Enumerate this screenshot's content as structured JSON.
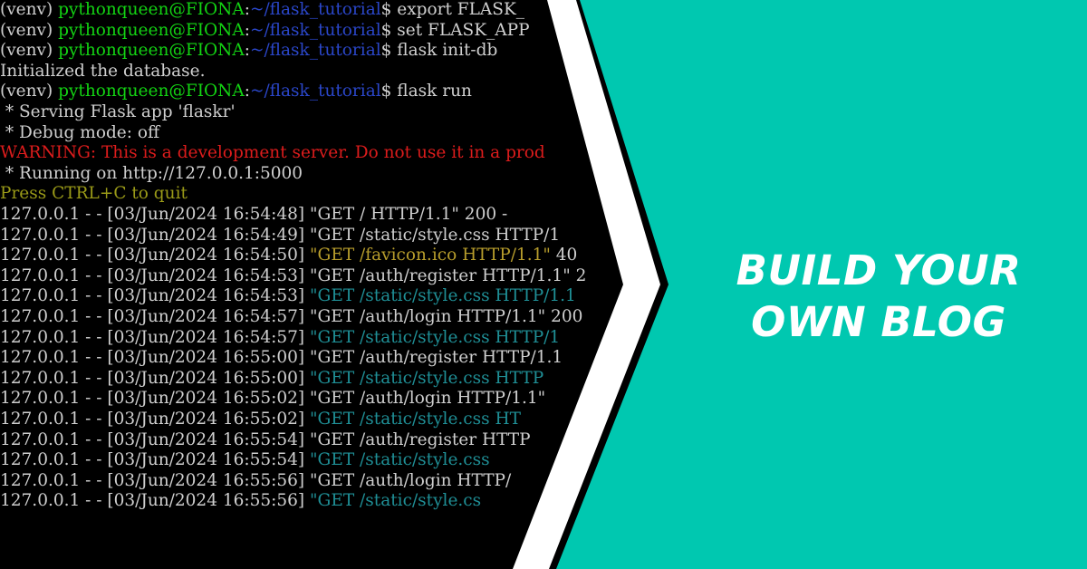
{
  "terminal": {
    "lines": [
      [
        {
          "t": "(venv) ",
          "c": "white"
        },
        {
          "t": "pythonqueen@FIONA",
          "c": "green"
        },
        {
          "t": ":",
          "c": "white"
        },
        {
          "t": "~/flask_tutorial",
          "c": "blue"
        },
        {
          "t": "$ export FLASK_",
          "c": "white"
        }
      ],
      [
        {
          "t": "(venv) ",
          "c": "white"
        },
        {
          "t": "pythonqueen@FIONA",
          "c": "green"
        },
        {
          "t": ":",
          "c": "white"
        },
        {
          "t": "~/flask_tutorial",
          "c": "blue"
        },
        {
          "t": "$ set FLASK_APP",
          "c": "white"
        }
      ],
      [
        {
          "t": "(venv) ",
          "c": "white"
        },
        {
          "t": "pythonqueen@FIONA",
          "c": "green"
        },
        {
          "t": ":",
          "c": "white"
        },
        {
          "t": "~/flask_tutorial",
          "c": "blue"
        },
        {
          "t": "$ flask init-db",
          "c": "white"
        }
      ],
      [
        {
          "t": "Initialized the database.",
          "c": "white"
        }
      ],
      [
        {
          "t": "(venv) ",
          "c": "white"
        },
        {
          "t": "pythonqueen@FIONA",
          "c": "green"
        },
        {
          "t": ":",
          "c": "white"
        },
        {
          "t": "~/flask_tutorial",
          "c": "blue"
        },
        {
          "t": "$ flask run",
          "c": "white"
        }
      ],
      [
        {
          "t": " * Serving Flask app 'flaskr'",
          "c": "white"
        }
      ],
      [
        {
          "t": " * Debug mode: off",
          "c": "white"
        }
      ],
      [
        {
          "t": "WARNING: This is a development server. Do not use it in a prod",
          "c": "red"
        }
      ],
      [
        {
          "t": " * Running on http://127.0.0.1:5000",
          "c": "white"
        }
      ],
      [
        {
          "t": "Press CTRL+C to quit",
          "c": "olive"
        }
      ],
      [
        {
          "t": "127.0.0.1 - - [03/Jun/2024 16:54:48] \"GET / HTTP/1.1\" 200 -",
          "c": "white"
        }
      ],
      [
        {
          "t": "127.0.0.1 - - [03/Jun/2024 16:54:49] \"GET /static/style.css HTTP/1",
          "c": "white"
        }
      ],
      [
        {
          "t": "127.0.0.1 - - [03/Jun/2024 16:54:50] ",
          "c": "white"
        },
        {
          "t": "\"GET /favicon.ico HTTP/1.1\"",
          "c": "amber"
        },
        {
          "t": " 40",
          "c": "white"
        }
      ],
      [
        {
          "t": "127.0.0.1 - - [03/Jun/2024 16:54:53] \"GET /auth/register HTTP/1.1\" 2",
          "c": "white"
        }
      ],
      [
        {
          "t": "127.0.0.1 - - [03/Jun/2024 16:54:53] ",
          "c": "white"
        },
        {
          "t": "\"GET /static/style.css HTTP/1.1",
          "c": "teal"
        }
      ],
      [
        {
          "t": "127.0.0.1 - - [03/Jun/2024 16:54:57] \"GET /auth/login HTTP/1.1\" 200",
          "c": "white"
        }
      ],
      [
        {
          "t": "127.0.0.1 - - [03/Jun/2024 16:54:57] ",
          "c": "white"
        },
        {
          "t": "\"GET /static/style.css HTTP/1",
          "c": "teal"
        }
      ],
      [
        {
          "t": "127.0.0.1 - - [03/Jun/2024 16:55:00] \"GET /auth/register HTTP/1.1",
          "c": "white"
        }
      ],
      [
        {
          "t": "127.0.0.1 - - [03/Jun/2024 16:55:00] ",
          "c": "white"
        },
        {
          "t": "\"GET /static/style.css HTTP",
          "c": "teal"
        }
      ],
      [
        {
          "t": "127.0.0.1 - - [03/Jun/2024 16:55:02] \"GET /auth/login HTTP/1.1\"",
          "c": "white"
        }
      ],
      [
        {
          "t": "127.0.0.1 - - [03/Jun/2024 16:55:02] ",
          "c": "white"
        },
        {
          "t": "\"GET /static/style.css HT",
          "c": "teal"
        }
      ],
      [
        {
          "t": "127.0.0.1 - - [03/Jun/2024 16:55:54] \"GET /auth/register HTTP",
          "c": "white"
        }
      ],
      [
        {
          "t": "127.0.0.1 - - [03/Jun/2024 16:55:54] ",
          "c": "white"
        },
        {
          "t": "\"GET /static/style.css",
          "c": "teal"
        }
      ],
      [
        {
          "t": "127.0.0.1 - - [03/Jun/2024 16:55:56] \"GET /auth/login HTTP/",
          "c": "white"
        }
      ],
      [
        {
          "t": "127.0.0.1 - - [03/Jun/2024 16:55:56] ",
          "c": "white"
        },
        {
          "t": "\"GET /static/style.cs",
          "c": "teal"
        }
      ]
    ]
  },
  "banner": {
    "title_line1": "BUILD YOUR",
    "title_line2": "OWN BLOG",
    "accent_color": "#00c8b0",
    "stripe_color": "#ffffff"
  }
}
